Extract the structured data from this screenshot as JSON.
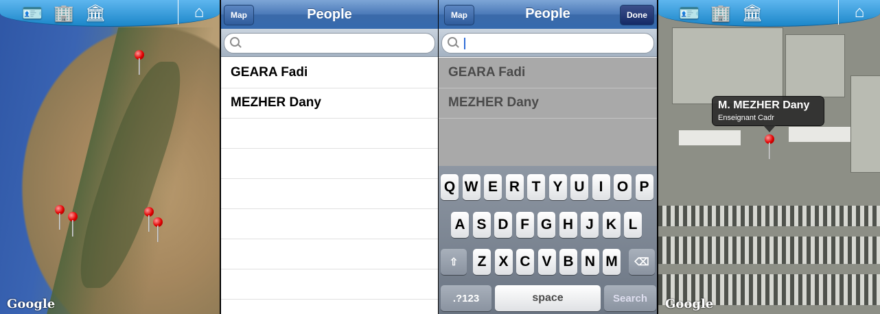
{
  "panel1": {
    "toolbar": {
      "icons": [
        "contact-card-icon",
        "building-icon",
        "campus-icon"
      ],
      "home_icon": "home-icon"
    },
    "map_attribution": "Google",
    "glyphs": {
      "contact": "🪪",
      "building": "🏢",
      "campus": "🏛",
      "home": "⌂"
    }
  },
  "panel2": {
    "nav": {
      "left_button": "Map",
      "title": "People"
    },
    "search": {
      "value": "",
      "placeholder": ""
    },
    "rows": [
      "GEARA Fadi",
      "MEZHER Dany"
    ]
  },
  "panel3": {
    "nav": {
      "left_button": "Map",
      "title": "People",
      "right_button": "Done"
    },
    "search": {
      "value": "",
      "placeholder": ""
    },
    "rows": [
      "GEARA Fadi",
      "MEZHER Dany"
    ],
    "keyboard": {
      "row1": [
        "Q",
        "W",
        "E",
        "R",
        "T",
        "Y",
        "U",
        "I",
        "O",
        "P"
      ],
      "row2": [
        "A",
        "S",
        "D",
        "F",
        "G",
        "H",
        "J",
        "K",
        "L"
      ],
      "row3": [
        "Z",
        "X",
        "C",
        "V",
        "B",
        "N",
        "M"
      ],
      "shift": "⇧",
      "backspace": "⌫",
      "numbers": ".?123",
      "space": "space",
      "search": "Search"
    }
  },
  "panel4": {
    "callout": {
      "name": "M. MEZHER Dany",
      "subtitle": "Enseignant Cadr"
    },
    "map_attribution": "Google"
  }
}
